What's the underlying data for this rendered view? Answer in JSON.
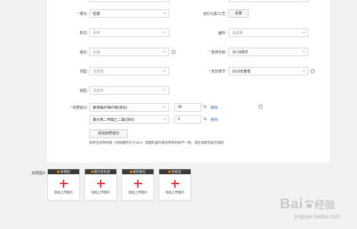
{
  "form": {
    "fabric": {
      "label": "* 裙长:",
      "value": "短裙"
    },
    "popular_elements": {
      "label": "流行元素/工艺:",
      "button": "设置"
    },
    "style": {
      "label": "款式:",
      "value": "吊带"
    },
    "material": {
      "label": "面料:",
      "placeholder": "请选择"
    },
    "sleeve": {
      "label": "袖长:",
      "value": "无袖"
    },
    "age": {
      "label": "* 适用年龄:",
      "value": "18-24周岁"
    },
    "collar": {
      "label": "领型:",
      "placeholder": "请选择"
    },
    "season": {
      "label": "* 年份季节:",
      "value": "2019年春季"
    },
    "sleeve_type": {
      "label": "袖型:",
      "placeholder": "请选择"
    },
    "composition": {
      "label": "* 材质成分:",
      "rows": [
        {
          "material": "聚苯酯纤维纤维(涤纶)",
          "percent": "95",
          "unit": "%",
          "delete": "删除"
        },
        {
          "material": "聚对苯二甲酸乙二酯(涤纶)",
          "percent": "5",
          "unit": "%",
          "delete": "删除"
        }
      ],
      "add_button": "添加材质成分",
      "tip": "如存在多种材质（材质面积大于15%）或面料里料填充物等材质不一致，请在详情页展示描述"
    }
  },
  "qualification": {
    "label": "资质图片",
    "cards": [
      {
        "title": "吊牌图",
        "caption": "添加上传图片"
      },
      {
        "title": "耐久性标签",
        "caption": "添加上传图片"
      },
      {
        "title": "质检报告",
        "caption": "添加上传图片"
      },
      {
        "title": "合格证",
        "caption": "添加上传图片"
      }
    ]
  },
  "watermark": {
    "brand": "Bai",
    "brand2": "经验",
    "url": "jingyan.baidu.com"
  },
  "colors": {
    "required": "#e4393c",
    "link": "#2a6fd6",
    "card_header": "#3b3b3b",
    "accent_dot": "#ff8a00"
  }
}
